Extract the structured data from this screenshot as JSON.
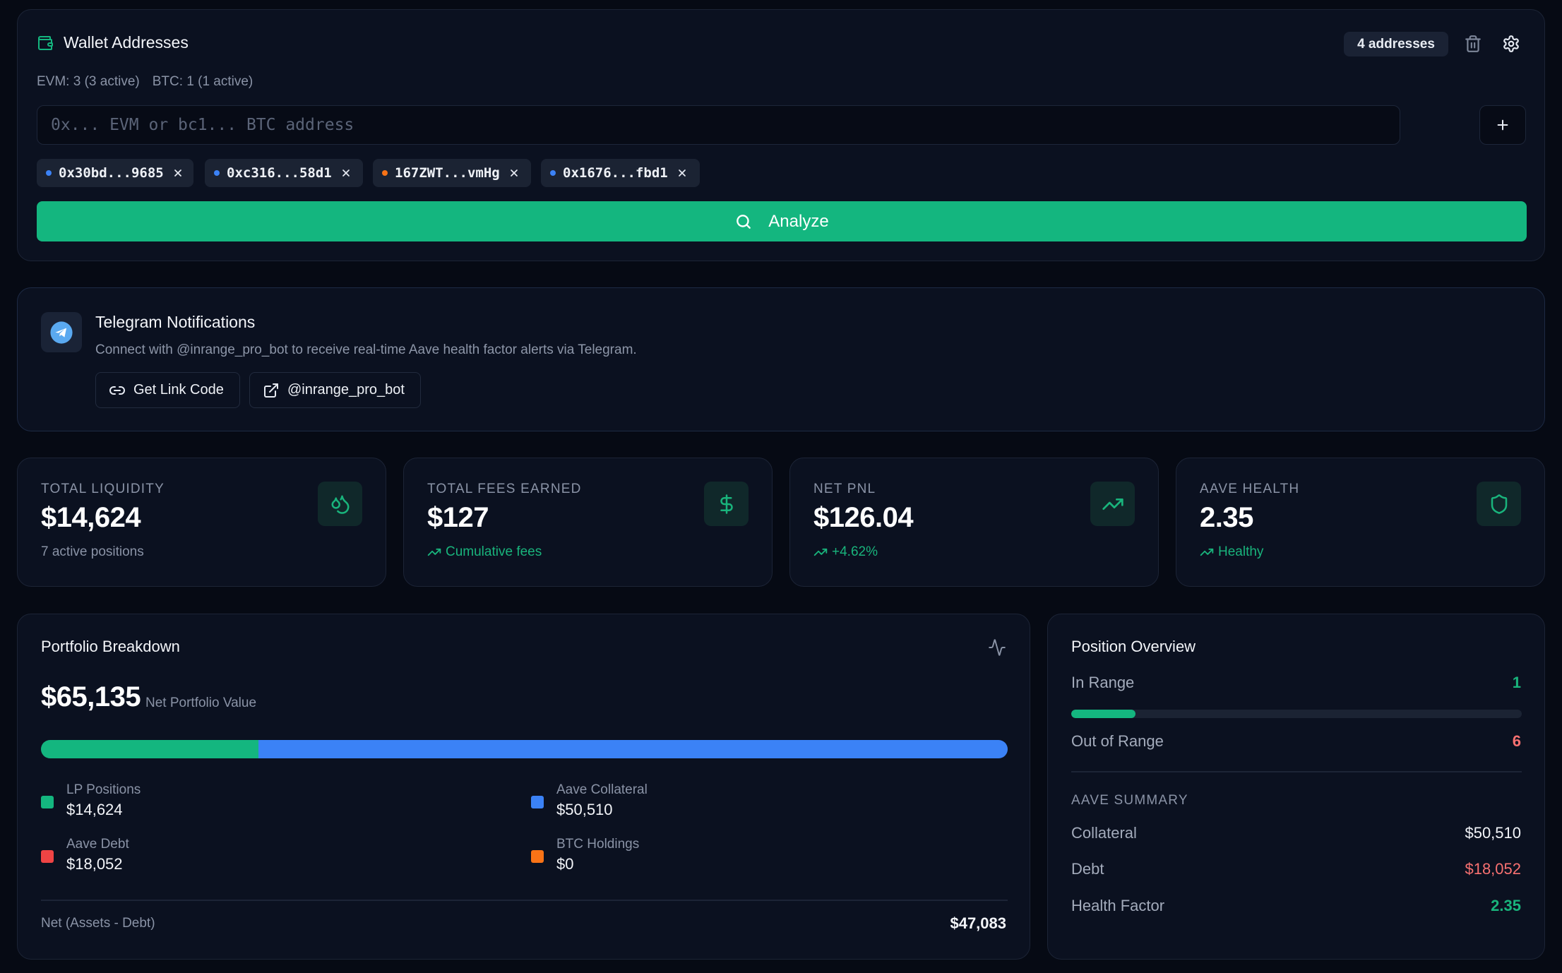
{
  "wallet": {
    "title": "Wallet Addresses",
    "count_badge": "4 addresses",
    "summary_evm": "EVM: 3 (3 active)",
    "summary_btc": "BTC: 1 (1 active)",
    "input_placeholder": "0x... EVM or bc1... BTC address",
    "chips": [
      {
        "label": "0x30bd...9685",
        "dot_color": "#3b82f6"
      },
      {
        "label": "0xc316...58d1",
        "dot_color": "#3b82f6"
      },
      {
        "label": "167ZWT...vmHg",
        "dot_color": "#f97316"
      },
      {
        "label": "0x1676...fbd1",
        "dot_color": "#3b82f6"
      }
    ],
    "analyze_label": "Analyze"
  },
  "telegram": {
    "title": "Telegram Notifications",
    "description": "Connect with @inrange_pro_bot to receive real-time Aave health factor alerts via Telegram.",
    "link_code_label": "Get Link Code",
    "bot_label": "@inrange_pro_bot"
  },
  "stats": [
    {
      "label": "TOTAL LIQUIDITY",
      "value": "$14,624",
      "sub": "7 active positions",
      "icon": "droplets-icon"
    },
    {
      "label": "TOTAL FEES EARNED",
      "value": "$127",
      "sub": "Cumulative fees",
      "icon": "dollar-icon"
    },
    {
      "label": "NET PNL",
      "value": "$126.04",
      "sub": "+4.62%",
      "icon": "trending-up-icon"
    },
    {
      "label": "AAVE HEALTH",
      "value": "2.35",
      "sub": "Healthy",
      "icon": "shield-icon"
    }
  ],
  "portfolio": {
    "title": "Portfolio Breakdown",
    "net_value": "$65,135",
    "net_value_label": "Net Portfolio Value",
    "bar_segments": [
      {
        "name": "LP Positions",
        "fraction": 0.225,
        "color": "#14b67f"
      },
      {
        "name": "Aave Collateral",
        "fraction": 0.775,
        "color": "#3b82f6"
      }
    ],
    "legend": [
      {
        "label": "LP Positions",
        "value": "$14,624",
        "color": "#14b67f"
      },
      {
        "label": "Aave Collateral",
        "value": "$50,510",
        "color": "#3b82f6"
      },
      {
        "label": "Aave Debt",
        "value": "$18,052",
        "color": "#ef4444"
      },
      {
        "label": "BTC Holdings",
        "value": "$0",
        "color": "#f97316"
      }
    ],
    "net_label": "Net (Assets - Debt)",
    "net_amount": "$47,083"
  },
  "positions": {
    "title": "Position Overview",
    "in_range_label": "In Range",
    "in_range_value": "1",
    "in_range_fraction": 0.143,
    "out_range_label": "Out of Range",
    "out_range_value": "6",
    "aave_section": "AAVE SUMMARY",
    "collateral_label": "Collateral",
    "collateral_value": "$50,510",
    "debt_label": "Debt",
    "debt_value": "$18,052",
    "hf_label": "Health Factor",
    "hf_value": "2.35"
  },
  "colors": {
    "accent_green": "#14b67f",
    "accent_blue": "#3b82f6",
    "danger_red": "#f87171",
    "warn_orange": "#f97316"
  }
}
